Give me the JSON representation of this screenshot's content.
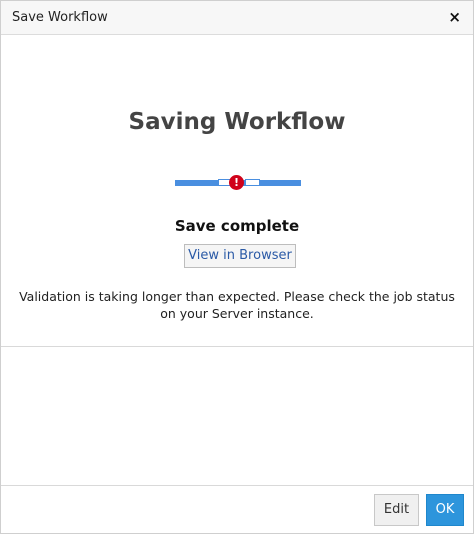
{
  "dialog": {
    "title": "Save Workflow",
    "close_icon": "close-icon",
    "close_glyph": "×"
  },
  "main": {
    "heading": "Saving Workflow",
    "progress": {
      "state": "error",
      "error_glyph": "!",
      "error_color": "#d0021b",
      "bar_color": "#4a8fe0"
    },
    "status": "Save complete",
    "view_button_label": "View in Browser",
    "message": "Validation is taking longer than expected. Please check the job status on your Server instance."
  },
  "footer": {
    "edit_label": "Edit",
    "ok_label": "OK",
    "ok_color": "#2d95dc"
  }
}
